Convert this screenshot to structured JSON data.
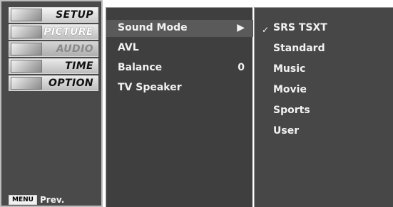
{
  "left_menu": {
    "items": [
      {
        "label": "SETUP",
        "icon": "antenna-icon"
      },
      {
        "label": "PICTURE",
        "icon": "color-bars-icon"
      },
      {
        "label": "AUDIO",
        "icon": "speaker-icon"
      },
      {
        "label": "TIME",
        "icon": "clock-icon"
      },
      {
        "label": "OPTION",
        "icon": "option-icon"
      }
    ],
    "menu_button": "MENU",
    "prev_label": "Prev."
  },
  "sound_menu": {
    "items": [
      {
        "label": "Sound Mode",
        "value": "▶"
      },
      {
        "label": "AVL",
        "value": ""
      },
      {
        "label": "Balance",
        "value": "0"
      },
      {
        "label": "TV Speaker",
        "value": ""
      }
    ]
  },
  "sound_mode_options": {
    "checkmark": "✓",
    "items": [
      "SRS TSXT",
      "Standard",
      "Music",
      "Movie",
      "Sports",
      "User"
    ],
    "selected_index": 0
  }
}
